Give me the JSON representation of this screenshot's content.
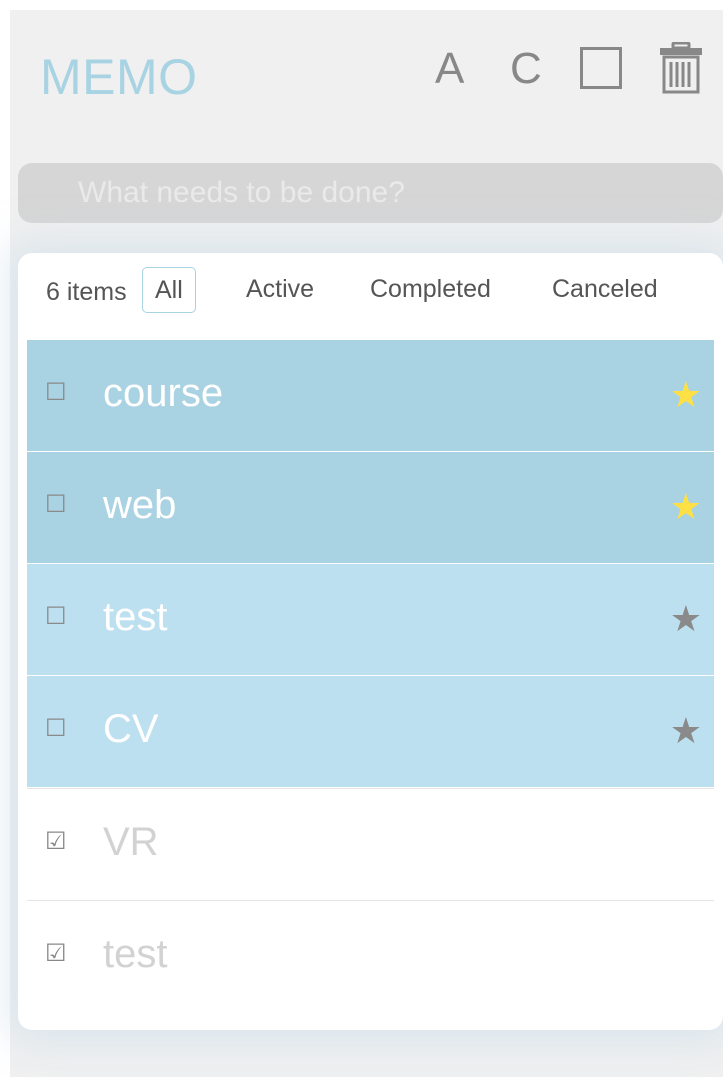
{
  "app": {
    "title": "MEMO"
  },
  "toolbar": {
    "sort_a_label": "A",
    "sort_c_label": "C"
  },
  "search": {
    "placeholder": "What needs to be done?"
  },
  "filters": {
    "count": "6 items",
    "all": "All",
    "active": "Active",
    "completed": "Completed",
    "canceled": "Canceled"
  },
  "todos": [
    {
      "label": "course",
      "checkbox": "☐",
      "star": "★"
    },
    {
      "label": "web",
      "checkbox": "☐",
      "star": "★"
    },
    {
      "label": "test",
      "checkbox": "☐",
      "star": "★"
    },
    {
      "label": "CV",
      "checkbox": "☐",
      "star": "★"
    },
    {
      "label": "VR",
      "checkbox": "☑"
    },
    {
      "label": "test",
      "checkbox": "☑"
    }
  ],
  "colors": {
    "accent": "#a8d3e3",
    "starred_row": "#a9d2e2",
    "plain_row": "#bde0f0",
    "star_on": "#ffe045",
    "star_off": "#8a8a8a"
  }
}
